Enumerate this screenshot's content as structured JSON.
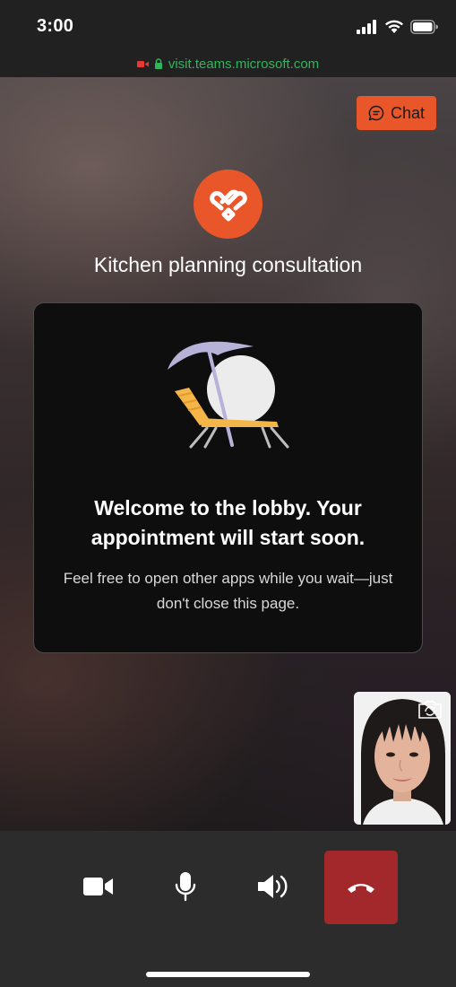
{
  "status_bar": {
    "time": "3:00"
  },
  "browser": {
    "url": "visit.teams.microsoft.com"
  },
  "chat_button": {
    "label": "Chat"
  },
  "meeting": {
    "title": "Kitchen planning consultation"
  },
  "lobby": {
    "heading": "Welcome to the lobby. Your appointment will start soon.",
    "body": "Feel free to open other apps while you wait—just don't close this page."
  },
  "controls": {
    "items": [
      {
        "icon": "video-camera-icon"
      },
      {
        "icon": "microphone-icon"
      },
      {
        "icon": "speaker-icon"
      },
      {
        "icon": "end-call-icon"
      }
    ]
  },
  "colors": {
    "accent": "#e8562a",
    "end_call": "#a3282b",
    "url_green": "#31b45a",
    "record_red": "#e53935"
  }
}
